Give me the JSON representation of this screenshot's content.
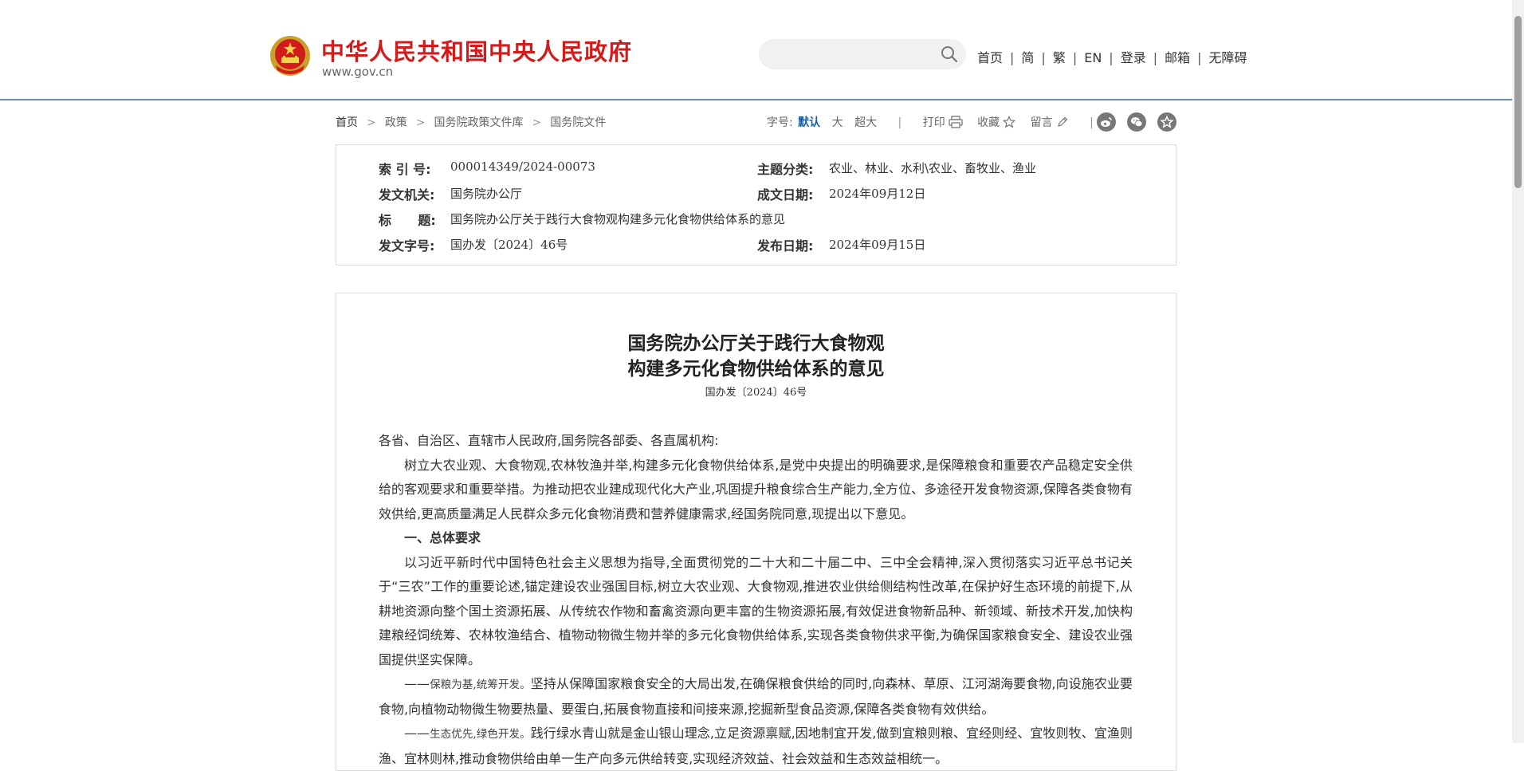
{
  "site": {
    "name": "中华人民共和国中央人民政府",
    "url": "www.gov.cn",
    "colors": {
      "brand_red": "#d21b1b",
      "accent_blue": "#1a5ea8",
      "rule": "#6f8aa6"
    }
  },
  "search": {
    "placeholder": "",
    "icon": "search-icon"
  },
  "topnav": {
    "items": [
      {
        "label": "首页"
      },
      {
        "label": "简"
      },
      {
        "label": "繁"
      },
      {
        "label": "EN"
      },
      {
        "label": "登录"
      },
      {
        "label": "邮箱"
      },
      {
        "label": "无障碍"
      }
    ],
    "separator": "|"
  },
  "breadcrumb": {
    "items": [
      {
        "label": "首页"
      },
      {
        "label": "政策"
      },
      {
        "label": "国务院政策文件库"
      },
      {
        "label": "国务院文件"
      }
    ],
    "separator": ">"
  },
  "toolbar": {
    "fontsize_label": "字号:",
    "fontsize_options": [
      "默认",
      "大",
      "超大"
    ],
    "fontsize_selected": "默认",
    "divider": "|",
    "print_label": "打印",
    "favorite_label": "收藏",
    "comment_label": "留言",
    "share_icons": [
      "weibo-icon",
      "wechat-icon",
      "favorite-star-icon"
    ]
  },
  "meta": {
    "index_label": "索 引 号:",
    "index_value": "000014349/2024-00073",
    "subject_label": "主题分类:",
    "subject_value": "农业、林业、水利\\农业、畜牧业、渔业",
    "issuer_label": "发文机关:",
    "issuer_value": "国务院办公厅",
    "written_label": "成文日期:",
    "written_value": "2024年09月12日",
    "title_label": "标      题:",
    "title_value": "国务院办公厅关于践行大食物观构建多元化食物供给体系的意见",
    "docno_label": "发文字号:",
    "docno_value": "国办发〔2024〕46号",
    "published_label": "发布日期:",
    "published_value": "2024年09月15日"
  },
  "article": {
    "title_line1": "国务院办公厅关于践行大食物观",
    "title_line2": "构建多元化食物供给体系的意见",
    "doc_number": "国办发〔2024〕46号",
    "salutation": "各省、自治区、直辖市人民政府,国务院各部委、各直属机构:",
    "para1": "树立大农业观、大食物观,农林牧渔并举,构建多元化食物供给体系,是党中央提出的明确要求,是保障粮食和重要农产品稳定安全供给的客观要求和重要举措。为推动把农业建成现代化大产业,巩固提升粮食综合生产能力,全方位、多途径开发食物资源,保障各类食物有效供给,更高质量满足人民群众多元化食物消费和营养健康需求,经国务院同意,现提出以下意见。",
    "heading1": "一、总体要求",
    "para2": "以习近平新时代中国特色社会主义思想为指导,全面贯彻党的二十大和二十届二中、三中全会精神,深入贯彻落实习近平总书记关于“三农”工作的重要论述,锚定建设农业强国目标,树立大农业观、大食物观,推进农业供给侧结构性改革,在保护好生态环境的前提下,从耕地资源向整个国土资源拓展、从传统农作物和畜禽资源向更丰富的生物资源拓展,有效促进食物新品种、新领域、新技术开发,加快构建粮经饲统筹、农林牧渔结合、植物动物微生物并举的多元化食物供给体系,实现各类食物供求平衡,为确保国家粮食安全、建设农业强国提供坚实保障。",
    "principle1_prefix": "——",
    "principle1_em": "保粮为基,统筹开发。",
    "principle1_text": "坚持从保障国家粮食安全的大局出发,在确保粮食供给的同时,向森林、草原、江河湖海要食物,向设施农业要食物,向植物动物微生物要热量、要蛋白,拓展食物直接和间接来源,挖掘新型食品资源,保障各类食物有效供给。",
    "principle2_prefix": "——",
    "principle2_em": "生态优先,绿色开发。",
    "principle2_text": "践行绿水青山就是金山银山理念,立足资源禀赋,因地制宜开发,做到宜粮则粮、宜经则经、宜牧则牧、宜渔则渔、宜林则林,推动食物供给由单一生产向多元供给转变,实现经济效益、社会效益和生态效益相统一。"
  }
}
